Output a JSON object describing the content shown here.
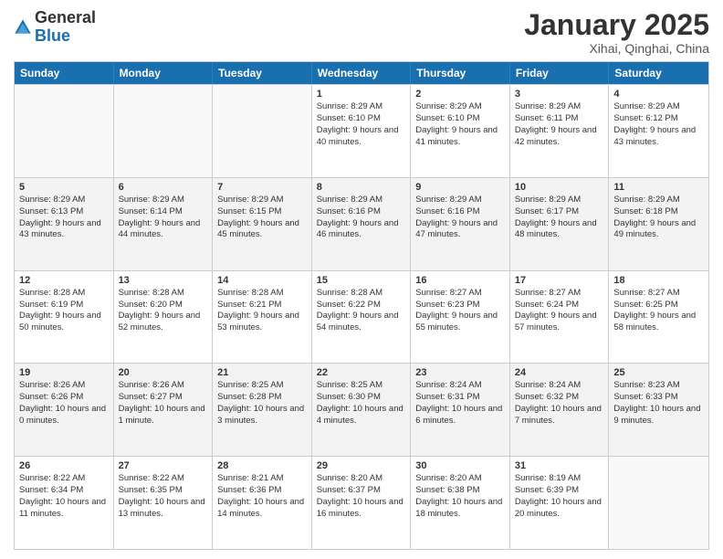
{
  "header": {
    "logo_general": "General",
    "logo_blue": "Blue",
    "month_title": "January 2025",
    "subtitle": "Xihai, Qinghai, China"
  },
  "days_of_week": [
    "Sunday",
    "Monday",
    "Tuesday",
    "Wednesday",
    "Thursday",
    "Friday",
    "Saturday"
  ],
  "rows": [
    [
      {
        "day": "",
        "text": ""
      },
      {
        "day": "",
        "text": ""
      },
      {
        "day": "",
        "text": ""
      },
      {
        "day": "1",
        "text": "Sunrise: 8:29 AM\nSunset: 6:10 PM\nDaylight: 9 hours and 40 minutes."
      },
      {
        "day": "2",
        "text": "Sunrise: 8:29 AM\nSunset: 6:10 PM\nDaylight: 9 hours and 41 minutes."
      },
      {
        "day": "3",
        "text": "Sunrise: 8:29 AM\nSunset: 6:11 PM\nDaylight: 9 hours and 42 minutes."
      },
      {
        "day": "4",
        "text": "Sunrise: 8:29 AM\nSunset: 6:12 PM\nDaylight: 9 hours and 43 minutes."
      }
    ],
    [
      {
        "day": "5",
        "text": "Sunrise: 8:29 AM\nSunset: 6:13 PM\nDaylight: 9 hours and 43 minutes."
      },
      {
        "day": "6",
        "text": "Sunrise: 8:29 AM\nSunset: 6:14 PM\nDaylight: 9 hours and 44 minutes."
      },
      {
        "day": "7",
        "text": "Sunrise: 8:29 AM\nSunset: 6:15 PM\nDaylight: 9 hours and 45 minutes."
      },
      {
        "day": "8",
        "text": "Sunrise: 8:29 AM\nSunset: 6:16 PM\nDaylight: 9 hours and 46 minutes."
      },
      {
        "day": "9",
        "text": "Sunrise: 8:29 AM\nSunset: 6:16 PM\nDaylight: 9 hours and 47 minutes."
      },
      {
        "day": "10",
        "text": "Sunrise: 8:29 AM\nSunset: 6:17 PM\nDaylight: 9 hours and 48 minutes."
      },
      {
        "day": "11",
        "text": "Sunrise: 8:29 AM\nSunset: 6:18 PM\nDaylight: 9 hours and 49 minutes."
      }
    ],
    [
      {
        "day": "12",
        "text": "Sunrise: 8:28 AM\nSunset: 6:19 PM\nDaylight: 9 hours and 50 minutes."
      },
      {
        "day": "13",
        "text": "Sunrise: 8:28 AM\nSunset: 6:20 PM\nDaylight: 9 hours and 52 minutes."
      },
      {
        "day": "14",
        "text": "Sunrise: 8:28 AM\nSunset: 6:21 PM\nDaylight: 9 hours and 53 minutes."
      },
      {
        "day": "15",
        "text": "Sunrise: 8:28 AM\nSunset: 6:22 PM\nDaylight: 9 hours and 54 minutes."
      },
      {
        "day": "16",
        "text": "Sunrise: 8:27 AM\nSunset: 6:23 PM\nDaylight: 9 hours and 55 minutes."
      },
      {
        "day": "17",
        "text": "Sunrise: 8:27 AM\nSunset: 6:24 PM\nDaylight: 9 hours and 57 minutes."
      },
      {
        "day": "18",
        "text": "Sunrise: 8:27 AM\nSunset: 6:25 PM\nDaylight: 9 hours and 58 minutes."
      }
    ],
    [
      {
        "day": "19",
        "text": "Sunrise: 8:26 AM\nSunset: 6:26 PM\nDaylight: 10 hours and 0 minutes."
      },
      {
        "day": "20",
        "text": "Sunrise: 8:26 AM\nSunset: 6:27 PM\nDaylight: 10 hours and 1 minute."
      },
      {
        "day": "21",
        "text": "Sunrise: 8:25 AM\nSunset: 6:28 PM\nDaylight: 10 hours and 3 minutes."
      },
      {
        "day": "22",
        "text": "Sunrise: 8:25 AM\nSunset: 6:30 PM\nDaylight: 10 hours and 4 minutes."
      },
      {
        "day": "23",
        "text": "Sunrise: 8:24 AM\nSunset: 6:31 PM\nDaylight: 10 hours and 6 minutes."
      },
      {
        "day": "24",
        "text": "Sunrise: 8:24 AM\nSunset: 6:32 PM\nDaylight: 10 hours and 7 minutes."
      },
      {
        "day": "25",
        "text": "Sunrise: 8:23 AM\nSunset: 6:33 PM\nDaylight: 10 hours and 9 minutes."
      }
    ],
    [
      {
        "day": "26",
        "text": "Sunrise: 8:22 AM\nSunset: 6:34 PM\nDaylight: 10 hours and 11 minutes."
      },
      {
        "day": "27",
        "text": "Sunrise: 8:22 AM\nSunset: 6:35 PM\nDaylight: 10 hours and 13 minutes."
      },
      {
        "day": "28",
        "text": "Sunrise: 8:21 AM\nSunset: 6:36 PM\nDaylight: 10 hours and 14 minutes."
      },
      {
        "day": "29",
        "text": "Sunrise: 8:20 AM\nSunset: 6:37 PM\nDaylight: 10 hours and 16 minutes."
      },
      {
        "day": "30",
        "text": "Sunrise: 8:20 AM\nSunset: 6:38 PM\nDaylight: 10 hours and 18 minutes."
      },
      {
        "day": "31",
        "text": "Sunrise: 8:19 AM\nSunset: 6:39 PM\nDaylight: 10 hours and 20 minutes."
      },
      {
        "day": "",
        "text": ""
      }
    ]
  ]
}
